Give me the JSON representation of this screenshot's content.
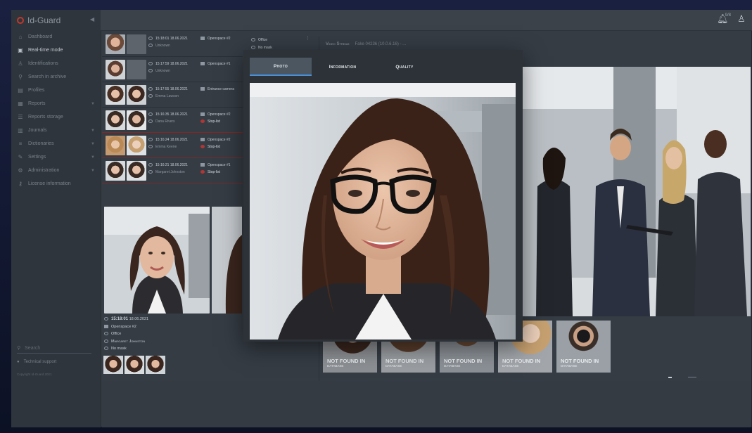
{
  "app": {
    "title": "Id-Guard"
  },
  "topbar": {
    "notifications_badge": "9/8"
  },
  "sidebar": {
    "items": [
      {
        "label": "Dashboard",
        "icon": "home-icon",
        "active": false
      },
      {
        "label": "Real-time mode",
        "icon": "monitor-icon",
        "active": true
      },
      {
        "label": "Identifications",
        "icon": "person-icon",
        "active": false
      },
      {
        "label": "Search in archive",
        "icon": "search-icon",
        "active": false
      },
      {
        "label": "Profiles",
        "icon": "profile-card-icon",
        "active": false
      },
      {
        "label": "Reports",
        "icon": "report-icon",
        "active": false
      },
      {
        "label": "Reports storage",
        "icon": "storage-icon",
        "active": false
      },
      {
        "label": "Journals",
        "icon": "journal-icon",
        "active": false
      },
      {
        "label": "Dictionaries",
        "icon": "list-icon",
        "active": false
      },
      {
        "label": "Settings",
        "icon": "wrench-icon",
        "active": false
      },
      {
        "label": "Administration",
        "icon": "gear-icon",
        "active": false
      },
      {
        "label": "License information",
        "icon": "key-icon",
        "active": false
      }
    ],
    "search_placeholder": "Search",
    "support_label": "Technical support",
    "copyright": "Copyright Id-Guard 2021"
  },
  "events": [
    {
      "time": "15:18:01",
      "date": "18.06.2021",
      "status": "Unknown",
      "camera": "Openspace #2",
      "stop": false
    },
    {
      "time": "15:17:59",
      "date": "18.06.2021",
      "status": "Unknown",
      "camera": "Openspace #1",
      "stop": false
    },
    {
      "time": "15:17:55",
      "date": "18.06.2021",
      "status": "Emma Lawson",
      "camera": "Entrance camera",
      "stop": false
    },
    {
      "time": "15:16:35",
      "date": "18.06.2021",
      "status": "Dana Rivers",
      "camera": "Openspace #2",
      "stop": true,
      "stop_label": "Stop-list"
    },
    {
      "time": "15:16:24",
      "date": "18.06.2021",
      "status": "Emma Keene",
      "camera": "Openspace #2",
      "stop": true,
      "stop_label": "Stop-list"
    },
    {
      "time": "15:16:21",
      "date": "18.06.2021",
      "status": "Margaret Johnston",
      "camera": "Openspace #1",
      "stop": true,
      "stop_label": "Stop-list"
    }
  ],
  "location": {
    "place": "Office",
    "mask": "No mask"
  },
  "detail": {
    "time": "15:18:01",
    "date": "18.06.2021",
    "camera": "Openspace #2",
    "place": "Office",
    "name": "Margaret Johnston",
    "mask": "No mask"
  },
  "video_stream": {
    "label": "Video Stream",
    "selected": "Fake 04236 (10.0.6.16) - ..."
  },
  "modal": {
    "tabs": [
      {
        "label": "Photo",
        "active": true
      },
      {
        "label": "Information",
        "active": false
      },
      {
        "label": "Quality",
        "active": false
      }
    ]
  },
  "not_found": [
    {
      "line1": "NOT FOUND IN",
      "line2": "DATABASE"
    },
    {
      "line1": "NOT FOUND IN",
      "line2": "DATABASE"
    },
    {
      "line1": "NOT FOUND IN",
      "line2": "DATABASE"
    },
    {
      "line1": "NOT FOUND IN",
      "line2": "DATABASE"
    },
    {
      "line1": "NOT FOUND IN",
      "line2": "DATABASE"
    }
  ],
  "colors": {
    "accent": "#4a90d9",
    "danger": "#b13636",
    "brand": "#c0392b"
  }
}
